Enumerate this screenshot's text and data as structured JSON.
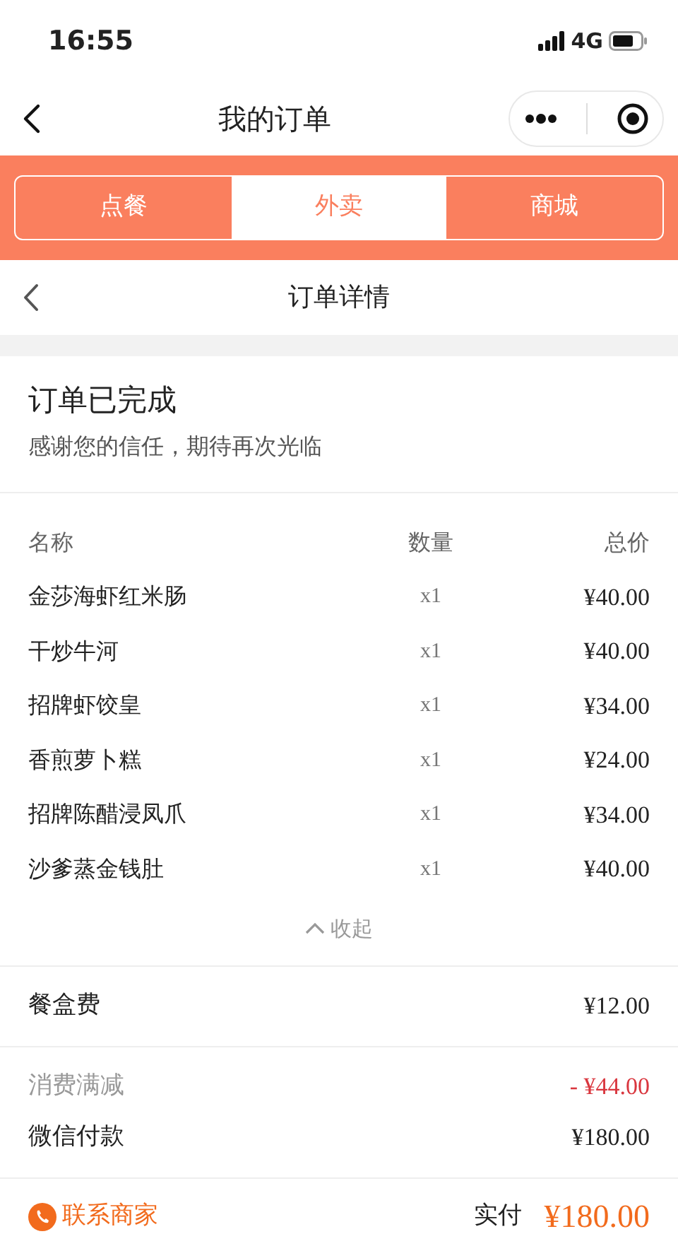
{
  "status_bar": {
    "time": "16:55",
    "network": "4G"
  },
  "nav": {
    "title": "我的订单"
  },
  "tabs": [
    {
      "label": "点餐",
      "selected": false
    },
    {
      "label": "外卖",
      "selected": true
    },
    {
      "label": "商城",
      "selected": false
    }
  ],
  "detail_header": {
    "title": "订单详情"
  },
  "order_status": {
    "title": "订单已完成",
    "message": "感谢您的信任，期待再次光临"
  },
  "table": {
    "columns": [
      "名称",
      "数量",
      "总价"
    ],
    "rows": [
      {
        "name": "金莎海虾红米肠",
        "qty": "x1",
        "price": "¥40.00"
      },
      {
        "name": "干炒牛河",
        "qty": "x1",
        "price": "¥40.00"
      },
      {
        "name": "招牌虾饺皇",
        "qty": "x1",
        "price": "¥34.00"
      },
      {
        "name": "香煎萝卜糕",
        "qty": "x1",
        "price": "¥24.00"
      },
      {
        "name": "招牌陈醋浸凤爪",
        "qty": "x1",
        "price": "¥34.00"
      },
      {
        "name": "沙爹蒸金钱肚",
        "qty": "x1",
        "price": "¥40.00"
      }
    ],
    "collapse": "收起"
  },
  "fee_groups": [
    [
      {
        "kind": "normal",
        "label": "餐盒费",
        "value": "¥12.00"
      }
    ],
    [
      {
        "kind": "discount",
        "label": "消费满减",
        "value": "- ¥44.00"
      },
      {
        "kind": "normal",
        "label": "微信付款",
        "value": "¥180.00"
      }
    ]
  ],
  "footer": {
    "contact": "联系商家",
    "paid_label": "实付",
    "paid_value": "¥180.00"
  }
}
